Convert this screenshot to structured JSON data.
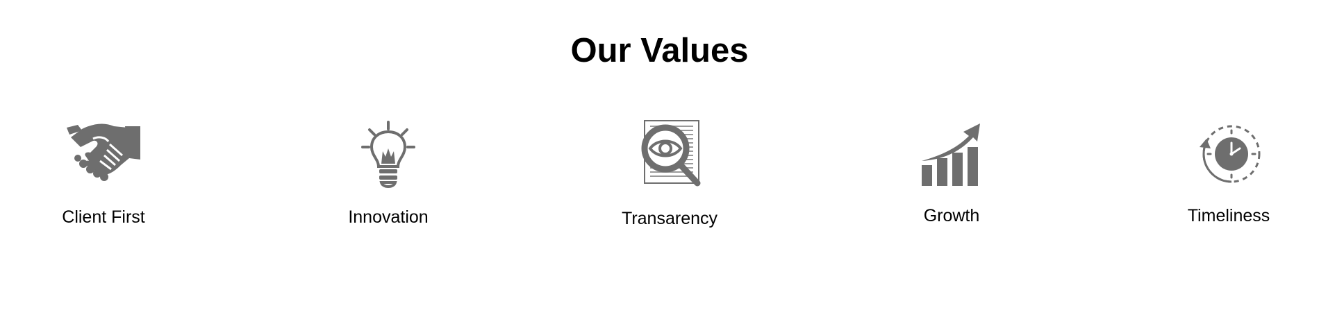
{
  "section": {
    "title": "Our Values"
  },
  "values": [
    {
      "label": "Client First",
      "icon": "handshake-icon"
    },
    {
      "label": "Innovation",
      "icon": "lightbulb-icon"
    },
    {
      "label": "Transarency",
      "icon": "magnifier-document-icon"
    },
    {
      "label": "Growth",
      "icon": "growth-chart-icon"
    },
    {
      "label": "Timeliness",
      "icon": "clock-icon"
    }
  ],
  "colors": {
    "icon": "#6e6e6e",
    "text": "#000000",
    "background": "#ffffff"
  }
}
